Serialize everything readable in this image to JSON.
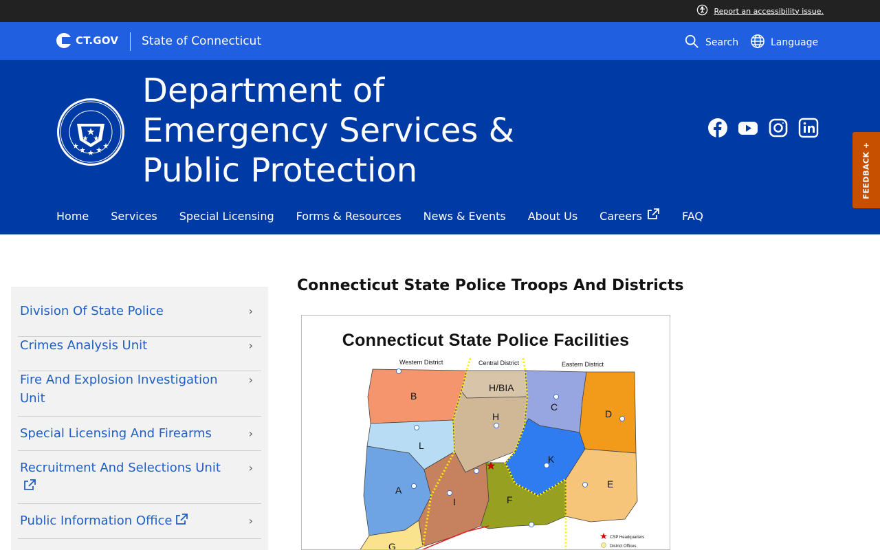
{
  "utility": {
    "accessibility_link": "Report an accessibility issue."
  },
  "ctgov": {
    "logo_text": "CT.GOV",
    "state_name": "State of Connecticut",
    "search_label": "Search",
    "language_label": "Language"
  },
  "agency": {
    "title": "Department of Emergency Services & Public Protection"
  },
  "nav": {
    "items": [
      {
        "label": "Home"
      },
      {
        "label": "Services"
      },
      {
        "label": "Special Licensing"
      },
      {
        "label": "Forms & Resources"
      },
      {
        "label": "News & Events"
      },
      {
        "label": "About Us"
      },
      {
        "label": "Careers"
      },
      {
        "label": "FAQ"
      }
    ]
  },
  "feedback": {
    "label": "FEEDBACK +"
  },
  "sidebar": {
    "items": [
      {
        "label": "Division Of State Police"
      },
      {
        "label": "Crimes Analysis Unit"
      },
      {
        "label": "Fire And Explosion Investigation Unit"
      },
      {
        "label": "Special Licensing And Firearms"
      },
      {
        "label": "Recruitment And Selections Unit"
      },
      {
        "label": "Public Information Office"
      }
    ]
  },
  "content": {
    "title": "Connecticut State Police Troops And Districts",
    "map": {
      "title": "Connecticut State Police Facilities",
      "districts": [
        "Western District",
        "Central District",
        "Eastern District"
      ],
      "troops": [
        "B",
        "H/BIA",
        "H",
        "C",
        "D",
        "L",
        "K",
        "A",
        "I",
        "F",
        "E",
        "G"
      ],
      "legend": [
        "CSP Headquarters",
        "District Offices"
      ]
    }
  },
  "colors": {
    "ctgov_blue": "#1f5fe0",
    "agency_blue": "#003ba5",
    "feedback_orange": "#c75000",
    "link_blue": "#1f5fc5"
  }
}
